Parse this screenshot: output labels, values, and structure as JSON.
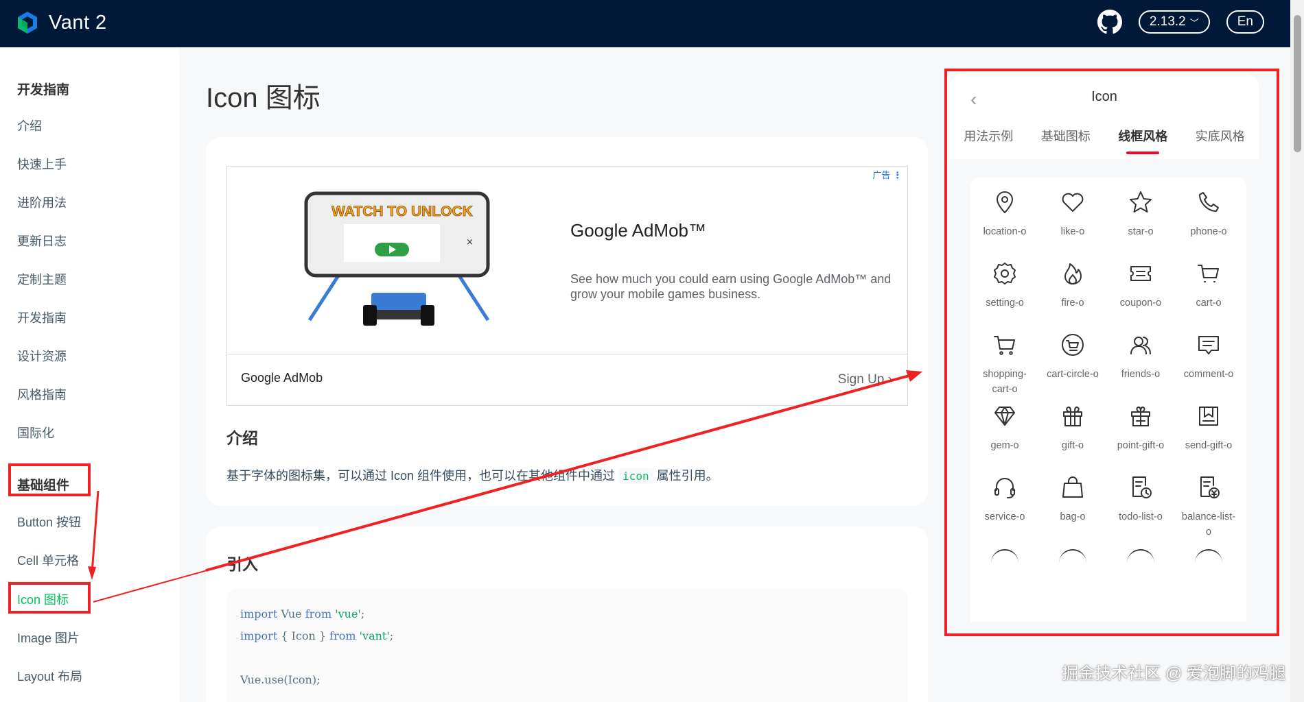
{
  "header": {
    "brand": "Vant 2",
    "version": "2.13.2",
    "lang": "En"
  },
  "sidebar": {
    "groups": [
      {
        "title": "开发指南",
        "items": [
          "介绍",
          "快速上手",
          "进阶用法",
          "更新日志",
          "定制主题",
          "开发指南",
          "设计资源",
          "风格指南",
          "国际化"
        ]
      },
      {
        "title": "基础组件",
        "items": [
          "Button 按钮",
          "Cell 单元格",
          "Icon 图标",
          "Image 图片",
          "Layout 布局"
        ]
      }
    ],
    "active_item": "Icon 图标"
  },
  "main": {
    "title": "Icon 图标",
    "ad": {
      "label": "广告",
      "unlock_text": "WATCH TO UNLOCK",
      "title": "Google AdMob™",
      "desc": "See how much you could earn using Google AdMob™ and grow your mobile games business.",
      "brand": "Google AdMob",
      "cta": "Sign Up"
    },
    "intro_title": "介绍",
    "intro_text_before": "基于字体的图标集，可以通过 Icon 组件使用，也可以在其他组件中通过",
    "intro_code": "icon",
    "intro_text_after": "属性引用。",
    "import_title": "引入",
    "code_lines": [
      [
        "import",
        " Vue ",
        "from",
        " 'vue'",
        ";"
      ],
      [
        "import",
        " { Icon } ",
        "from",
        " 'vant'",
        ";"
      ],
      [
        "",
        "",
        "",
        "",
        ""
      ],
      [
        "",
        "Vue.use(Icon);",
        "",
        "",
        ""
      ]
    ]
  },
  "simulator": {
    "title": "Icon",
    "tabs": [
      "用法示例",
      "基础图标",
      "线框风格",
      "实底风格"
    ],
    "active_tab": 2,
    "icons": [
      {
        "name": "location-o",
        "icon": "location-icon"
      },
      {
        "name": "like-o",
        "icon": "heart-icon"
      },
      {
        "name": "star-o",
        "icon": "star-icon"
      },
      {
        "name": "phone-o",
        "icon": "phone-icon"
      },
      {
        "name": "setting-o",
        "icon": "gear-icon"
      },
      {
        "name": "fire-o",
        "icon": "fire-icon"
      },
      {
        "name": "coupon-o",
        "icon": "coupon-icon"
      },
      {
        "name": "cart-o",
        "icon": "cart-icon"
      },
      {
        "name": "shopping-cart-o",
        "label_lines": [
          "shopping-",
          "cart-o"
        ],
        "icon": "shopping-cart-icon"
      },
      {
        "name": "cart-circle-o",
        "icon": "cart-circle-icon"
      },
      {
        "name": "friends-o",
        "icon": "friends-icon"
      },
      {
        "name": "comment-o",
        "icon": "comment-icon"
      },
      {
        "name": "gem-o",
        "icon": "gem-icon"
      },
      {
        "name": "gift-o",
        "icon": "gift-icon"
      },
      {
        "name": "point-gift-o",
        "icon": "point-gift-icon"
      },
      {
        "name": "send-gift-o",
        "icon": "send-gift-icon"
      },
      {
        "name": "service-o",
        "icon": "headset-icon"
      },
      {
        "name": "bag-o",
        "icon": "bag-icon"
      },
      {
        "name": "todo-list-o",
        "icon": "todo-list-icon"
      },
      {
        "name": "balance-list-o",
        "label_lines": [
          "balance-list-",
          "o"
        ],
        "icon": "balance-list-icon"
      }
    ]
  },
  "watermark": "掘金技术社区 @ 爱泡脚的鸡腿",
  "colors": {
    "header_bg": "#001938",
    "accent": "#07c160",
    "annotation": "#ee2222",
    "tab_underline": "#ee0a24"
  }
}
